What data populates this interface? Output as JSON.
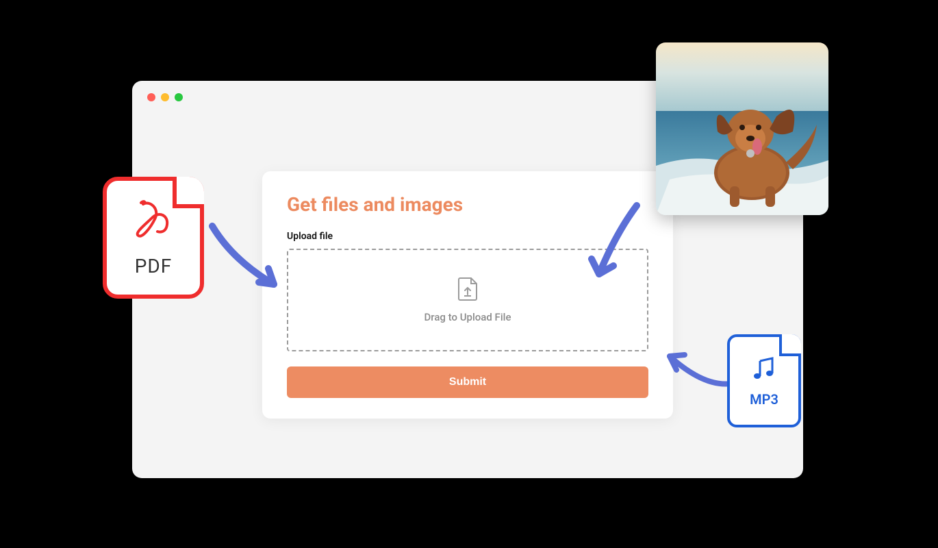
{
  "form": {
    "title": "Get files and images",
    "upload_label": "Upload file",
    "dropzone_text": "Drag to Upload File",
    "submit_label": "Submit"
  },
  "badges": {
    "pdf_label": "PDF",
    "mp3_label": "MP3"
  },
  "colors": {
    "accent": "#ed8c62",
    "pdf_border": "#ef2d2d",
    "mp3_border": "#1e5fd8",
    "arrow": "#5b6fd6"
  }
}
